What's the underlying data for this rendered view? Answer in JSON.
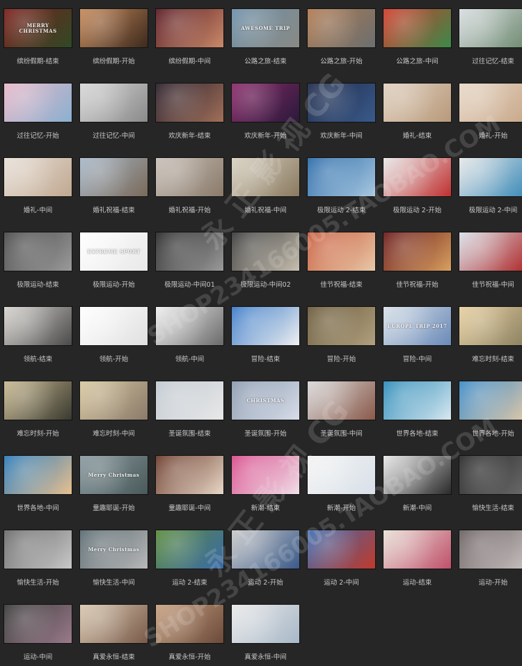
{
  "thumbnails": [
    {
      "label": "缤纷假期-结束",
      "text": "MERRY CHRISTMAS",
      "c1": "#7a1e1a",
      "c2": "#2f4a26"
    },
    {
      "label": "缤纷假期-开始",
      "text": "",
      "c1": "#c78a5a",
      "c2": "#3d2a1e"
    },
    {
      "label": "缤纷假期-中间",
      "text": "",
      "c1": "#5a1a22",
      "c2": "#c98a6a"
    },
    {
      "label": "公路之旅-结束",
      "text": "AWESOME TRIP",
      "c1": "#6d8fa8",
      "c2": "#8a8a84"
    },
    {
      "label": "公路之旅-开始",
      "text": "",
      "c1": "#b07a50",
      "c2": "#6b6f70"
    },
    {
      "label": "公路之旅-中间",
      "text": "",
      "c1": "#d23a2a",
      "c2": "#3a8a4a"
    },
    {
      "label": "过往记忆-结束",
      "text": "",
      "c1": "#d8dde0",
      "c2": "#6e8a70"
    },
    {
      "label": "过往记忆-开始",
      "text": "",
      "c1": "#e8b8c8",
      "c2": "#8ab0d0"
    },
    {
      "label": "过往记忆-中间",
      "text": "",
      "c1": "#d8d8d8",
      "c2": "#8a8a8a"
    },
    {
      "label": "欢庆新年-结束",
      "text": "",
      "c1": "#2a1e2a",
      "c2": "#a0705a"
    },
    {
      "label": "欢庆新年-开始",
      "text": "",
      "c1": "#8a2a6a",
      "c2": "#2a1a3a"
    },
    {
      "label": "欢庆新年-中间",
      "text": "",
      "c1": "#1e2a4a",
      "c2": "#3a5a8a"
    },
    {
      "label": "婚礼-结束",
      "text": "",
      "c1": "#e0d0c0",
      "c2": "#b89a7a"
    },
    {
      "label": "婚礼-开始",
      "text": "",
      "c1": "#e8d8c8",
      "c2": "#c8a88a"
    },
    {
      "label": "婚礼-中间",
      "text": "",
      "c1": "#e8e0d8",
      "c2": "#c0a890"
    },
    {
      "label": "婚礼祝福-结束",
      "text": "",
      "c1": "#a8b8c8",
      "c2": "#7a6a5a"
    },
    {
      "label": "婚礼祝福-开始",
      "text": "",
      "c1": "#c8c0b8",
      "c2": "#8a7a6a"
    },
    {
      "label": "婚礼祝福-中间",
      "text": "",
      "c1": "#d8d0c0",
      "c2": "#8a7a60"
    },
    {
      "label": "极限运动 2-结束",
      "text": "",
      "c1": "#2a6aa8",
      "c2": "#a8c8e0"
    },
    {
      "label": "极限运动 2-开始",
      "text": "",
      "c1": "#e8e8e8",
      "c2": "#c03030"
    },
    {
      "label": "极限运动 2-中间",
      "text": "",
      "c1": "#e8e8e8",
      "c2": "#3a8ab8"
    },
    {
      "label": "极限运动-结束",
      "text": "",
      "c1": "#4a4a4a",
      "c2": "#9a9a9a"
    },
    {
      "label": "极限运动-开始",
      "text": "EXTREME SPORT",
      "c1": "#ffffff",
      "c2": "#e8e8e8"
    },
    {
      "label": "极限运动-中间01",
      "text": "",
      "c1": "#2a2a2a",
      "c2": "#9a9a9a"
    },
    {
      "label": "极限运动-中间02",
      "text": "",
      "c1": "#3a3a3a",
      "c2": "#c8c0b0"
    },
    {
      "label": "佳节祝福-结束",
      "text": "",
      "c1": "#c85a3a",
      "c2": "#e8c8a8"
    },
    {
      "label": "佳节祝福-开始",
      "text": "",
      "c1": "#6a1a1a",
      "c2": "#d8a060"
    },
    {
      "label": "佳节祝福-中间",
      "text": "",
      "c1": "#d8e0e8",
      "c2": "#b02a2a"
    },
    {
      "label": "领航-结束",
      "text": "",
      "c1": "#d8d4d0",
      "c2": "#4a4a4a"
    },
    {
      "label": "领航-开始",
      "text": "",
      "c1": "#ffffff",
      "c2": "#e0e0e0"
    },
    {
      "label": "领航-中间",
      "text": "",
      "c1": "#f0f0f0",
      "c2": "#6a6a6a"
    },
    {
      "label": "冒险-结束",
      "text": "",
      "c1": "#3a7ac8",
      "c2": "#f0f0f0"
    },
    {
      "label": "冒险-开始",
      "text": "",
      "c1": "#6a5a3a",
      "c2": "#b0a080"
    },
    {
      "label": "冒险-中间",
      "text": "EUROPE TRIP 2017",
      "c1": "#d8e0e8",
      "c2": "#6a8ab8"
    },
    {
      "label": "难忘时刻-结束",
      "text": "",
      "c1": "#e8d0a0",
      "c2": "#8a8060"
    },
    {
      "label": "难忘时刻-开始",
      "text": "",
      "c1": "#c8b890",
      "c2": "#3a3a30"
    },
    {
      "label": "难忘时刻-中间",
      "text": "",
      "c1": "#d8c8a0",
      "c2": "#8a7a6a"
    },
    {
      "label": "圣诞氛围-结束",
      "text": "",
      "c1": "#c0c8d0",
      "c2": "#e8e8e8"
    },
    {
      "label": "圣诞氛围-开始",
      "text": "CHRISTMAS",
      "c1": "#8a9ab0",
      "c2": "#d8dde8"
    },
    {
      "label": "圣诞氛围-中间",
      "text": "",
      "c1": "#d8d8d8",
      "c2": "#8a5a4a"
    },
    {
      "label": "世界各地-结束",
      "text": "",
      "c1": "#2a8ab8",
      "c2": "#d8e8f0"
    },
    {
      "label": "世界各地-开始",
      "text": "",
      "c1": "#3a8ac8",
      "c2": "#e0c8a8"
    },
    {
      "label": "世界各地-中间",
      "text": "",
      "c1": "#2a7ab8",
      "c2": "#e8c090"
    },
    {
      "label": "童趣耶诞-开始",
      "text": "Merry Christmas",
      "c1": "#8a9aa0",
      "c2": "#4a5a5a"
    },
    {
      "label": "童趣耶诞-中间",
      "text": "",
      "c1": "#6a3a2a",
      "c2": "#e8d8c8"
    },
    {
      "label": "新潮-结束",
      "text": "",
      "c1": "#d84a8a",
      "c2": "#f0e0e8"
    },
    {
      "label": "新潮-开始",
      "text": "",
      "c1": "#f4f4f4",
      "c2": "#d8e0e8"
    },
    {
      "label": "新潮-中间",
      "text": "",
      "c1": "#e8e8e8",
      "c2": "#2a2a2a"
    },
    {
      "label": "愉快生活-结束",
      "text": "",
      "c1": "#2a2a2a",
      "c2": "#6a6a6a"
    },
    {
      "label": "愉快生活-开始",
      "text": "",
      "c1": "#6a6a6a",
      "c2": "#c8c8c8"
    },
    {
      "label": "愉快生活-中间",
      "text": "Merry Christmas",
      "c1": "#5a6a70",
      "c2": "#b8b8b8"
    },
    {
      "label": "运动 2-结束",
      "text": "",
      "c1": "#5a8a3a",
      "c2": "#3a6aa8"
    },
    {
      "label": "运动 2-开始",
      "text": "",
      "c1": "#c8c8c8",
      "c2": "#3a5a8a"
    },
    {
      "label": "运动 2-中间",
      "text": "",
      "c1": "#3a6ab0",
      "c2": "#c03a2a"
    },
    {
      "label": "运动-结束",
      "text": "",
      "c1": "#e8e0d8",
      "c2": "#c0506a"
    },
    {
      "label": "运动-开始",
      "text": "",
      "c1": "#6a6060",
      "c2": "#c8c0c0"
    },
    {
      "label": "运动-中间",
      "text": "",
      "c1": "#3a3a3a",
      "c2": "#9a7a8a"
    },
    {
      "label": "真爱永恒-结束",
      "text": "",
      "c1": "#d8c8b0",
      "c2": "#7a5a4a"
    },
    {
      "label": "真爱永恒-开始",
      "text": "",
      "c1": "#c8a080",
      "c2": "#6a4a3a"
    },
    {
      "label": "真爱永恒-中间",
      "text": "",
      "c1": "#e8e8e8",
      "c2": "#a8b8c8"
    }
  ],
  "watermarks": [
    "永 正 影 视 CG",
    "SHOP234166005.TAOBAO.COM",
    "永 正 影 视 CG",
    "SHOP234166005.TAOBAO.COM"
  ]
}
